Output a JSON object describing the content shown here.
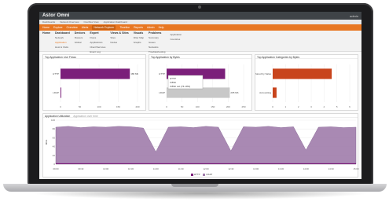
{
  "app": {
    "brand": "Astor Omni",
    "subtitle": "",
    "user": "admin"
  },
  "breadcrumbs": [
    "Dashboards",
    "Network Overview",
    "Overflow View",
    "Application Dashboard"
  ],
  "navbar": {
    "items": [
      "Home",
      "Explore",
      "Overview",
      "Alerts",
      "Network Explorer",
      "Timeline",
      "Reports",
      "Admin",
      "Help"
    ],
    "active_index": 4
  },
  "menu": {
    "columns": [
      {
        "head": "Home",
        "items": []
      },
      {
        "head": "Dashboard",
        "items": [
          "Network",
          "Application",
          "Host & Visits"
        ],
        "selected": 1
      },
      {
        "head": "Devices",
        "items": [
          "Routers",
          "Global"
        ]
      },
      {
        "head": "Expert",
        "items": [
          "Flows",
          "Applications",
          "Client/Services",
          "Event Log"
        ]
      },
      {
        "head": "Views & Sites",
        "items": [
          "Sites",
          "Nodes"
        ]
      },
      {
        "head": "Visuals",
        "items": [
          "Filter Map",
          "Graphs"
        ]
      },
      {
        "head": "Problems",
        "items": [
          "Summary",
          "Issues",
          "Networks",
          "Troubleshooting"
        ]
      },
      {
        "head": "",
        "items": [
          "Application",
          "Countries"
        ]
      }
    ]
  },
  "panels": {
    "p1": {
      "title": "Top Application Live Flows",
      "chart_data": {
        "type": "bar",
        "orientation": "horizontal",
        "categories": [
          "HTTP",
          "LDAP"
        ],
        "values": [
          180,
          2
        ],
        "xlim": [
          0,
          200
        ],
        "xticks": [
          "0",
          "50",
          "100",
          "150",
          "200"
        ],
        "value_labels": [
          "180 Mb",
          ""
        ]
      }
    },
    "p2": {
      "title": "Top Application by Bytes",
      "tooltip": [
        "HTTP",
        "3.8Gb",
        "3.8Gb out (74.19%)"
      ],
      "chart_data": {
        "type": "bar",
        "orientation": "horizontal",
        "categories": [
          "HTTP",
          "LDAP"
        ],
        "values": [
          190,
          205
        ],
        "xlim": [
          0,
          250
        ],
        "xticks": [
          "0",
          "50",
          "100",
          "150",
          "200",
          "250"
        ],
        "value_labels": [
          "",
          "205 Mb"
        ]
      }
    },
    "p3": {
      "title": "Top Application Categories by Bytes",
      "chart_data": {
        "type": "bar",
        "orientation": "horizontal",
        "categories": [
          "Shared by Sales",
          "Accounting"
        ],
        "values": [
          4.6,
          0.3
        ],
        "xlim": [
          0,
          6
        ],
        "xticks": [
          "0",
          "1",
          "2",
          "3",
          "4",
          "5",
          "6"
        ],
        "value_labels": [
          "",
          ""
        ]
      }
    }
  },
  "utilization": {
    "title": "Application Utilization",
    "subtitle": "Application over time",
    "ylabel": "Mb/s",
    "legend": [
      "HTTP",
      "LDAP"
    ],
    "chart_data": {
      "type": "area",
      "ylim": [
        0,
        100
      ],
      "yticks": [
        "100",
        "80",
        "60",
        "40",
        "20",
        "0"
      ],
      "x": [
        "09:00",
        "09:15",
        "09:30",
        "09:45",
        "10:00",
        "10:15",
        "10:30",
        "10:45",
        "11:00",
        "11:15",
        "11:30",
        "11:45",
        "12:00",
        "12:15",
        "12:30",
        "12:45",
        "13:00",
        "13:15",
        "13:30",
        "13:45",
        "14:00",
        "14:15",
        "14:30",
        "14:45",
        "15:00"
      ],
      "series": [
        {
          "name": "HTTP",
          "values": [
            84,
            86,
            83,
            85,
            84,
            86,
            85,
            82,
            28,
            84,
            85,
            83,
            86,
            84,
            30,
            85,
            84,
            86,
            83,
            85,
            32,
            84,
            85,
            83,
            84
          ]
        },
        {
          "name": "LDAP",
          "values": [
            2,
            2,
            2,
            2,
            2,
            2,
            2,
            2,
            2,
            2,
            2,
            2,
            2,
            2,
            2,
            2,
            2,
            2,
            2,
            2,
            2,
            2,
            2,
            2,
            2
          ]
        }
      ]
    }
  },
  "colors": {
    "accent": "#e87722",
    "purple": "#7b1f7a",
    "area": "#a07cab",
    "orange_bar": "#c8441c",
    "gray_bar": "#c8c8c8"
  }
}
